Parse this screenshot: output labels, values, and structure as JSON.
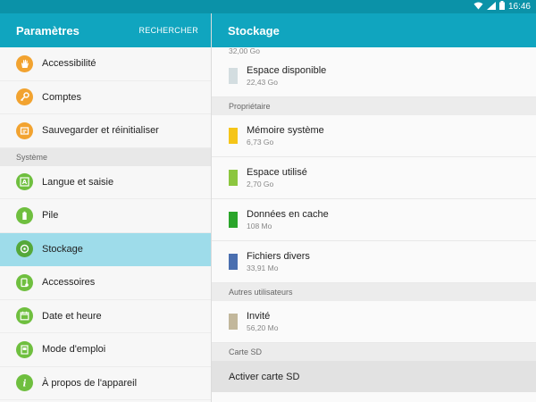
{
  "status_bar": {
    "time": "16:46",
    "icons": [
      "wifi-icon",
      "signal-icon",
      "battery-icon"
    ]
  },
  "left": {
    "title": "Paramètres",
    "search_label": "RECHERCHER",
    "items_top": [
      {
        "label": "Accessibilité",
        "icon": "hand-icon",
        "color": "#f2a330"
      },
      {
        "label": "Comptes",
        "icon": "key-icon",
        "color": "#f2a330"
      },
      {
        "label": "Sauvegarder et réinitialiser",
        "icon": "backup-icon",
        "color": "#f2a330"
      }
    ],
    "section_system": "Système",
    "items_system": [
      {
        "label": "Langue et saisie",
        "icon": "language-icon",
        "color": "#6fbf3f"
      },
      {
        "label": "Pile",
        "icon": "battery-icon",
        "color": "#6fbf3f"
      },
      {
        "label": "Stockage",
        "icon": "storage-icon",
        "color": "#6fbf3f",
        "selected": true
      },
      {
        "label": "Accessoires",
        "icon": "accessories-icon",
        "color": "#6fbf3f"
      },
      {
        "label": "Date et heure",
        "icon": "calendar-icon",
        "color": "#6fbf3f"
      },
      {
        "label": "Mode d'emploi",
        "icon": "manual-icon",
        "color": "#6fbf3f"
      },
      {
        "label": "À propos de l'appareil",
        "icon": "info-icon",
        "color": "#6fbf3f"
      }
    ]
  },
  "right": {
    "title": "Stockage",
    "top_size": "32,00 Go",
    "available": {
      "name": "Espace disponible",
      "size": "22,43 Go",
      "color": "#d3dde0"
    },
    "section_owner": "Propriétaire",
    "owner_items": [
      {
        "name": "Mémoire système",
        "size": "6,73 Go",
        "color": "#f5c518"
      },
      {
        "name": "Espace utilisé",
        "size": "2,70 Go",
        "color": "#8cc63f"
      },
      {
        "name": "Données en cache",
        "size": "108 Mo",
        "color": "#2aa52a"
      },
      {
        "name": "Fichiers divers",
        "size": "33,91 Mo",
        "color": "#4a6fb0"
      }
    ],
    "section_other_users": "Autres utilisateurs",
    "guest": {
      "name": "Invité",
      "size": "56,20 Mo",
      "color": "#c2b79b"
    },
    "section_sd": "Carte SD",
    "sd_button": "Activer carte SD"
  }
}
